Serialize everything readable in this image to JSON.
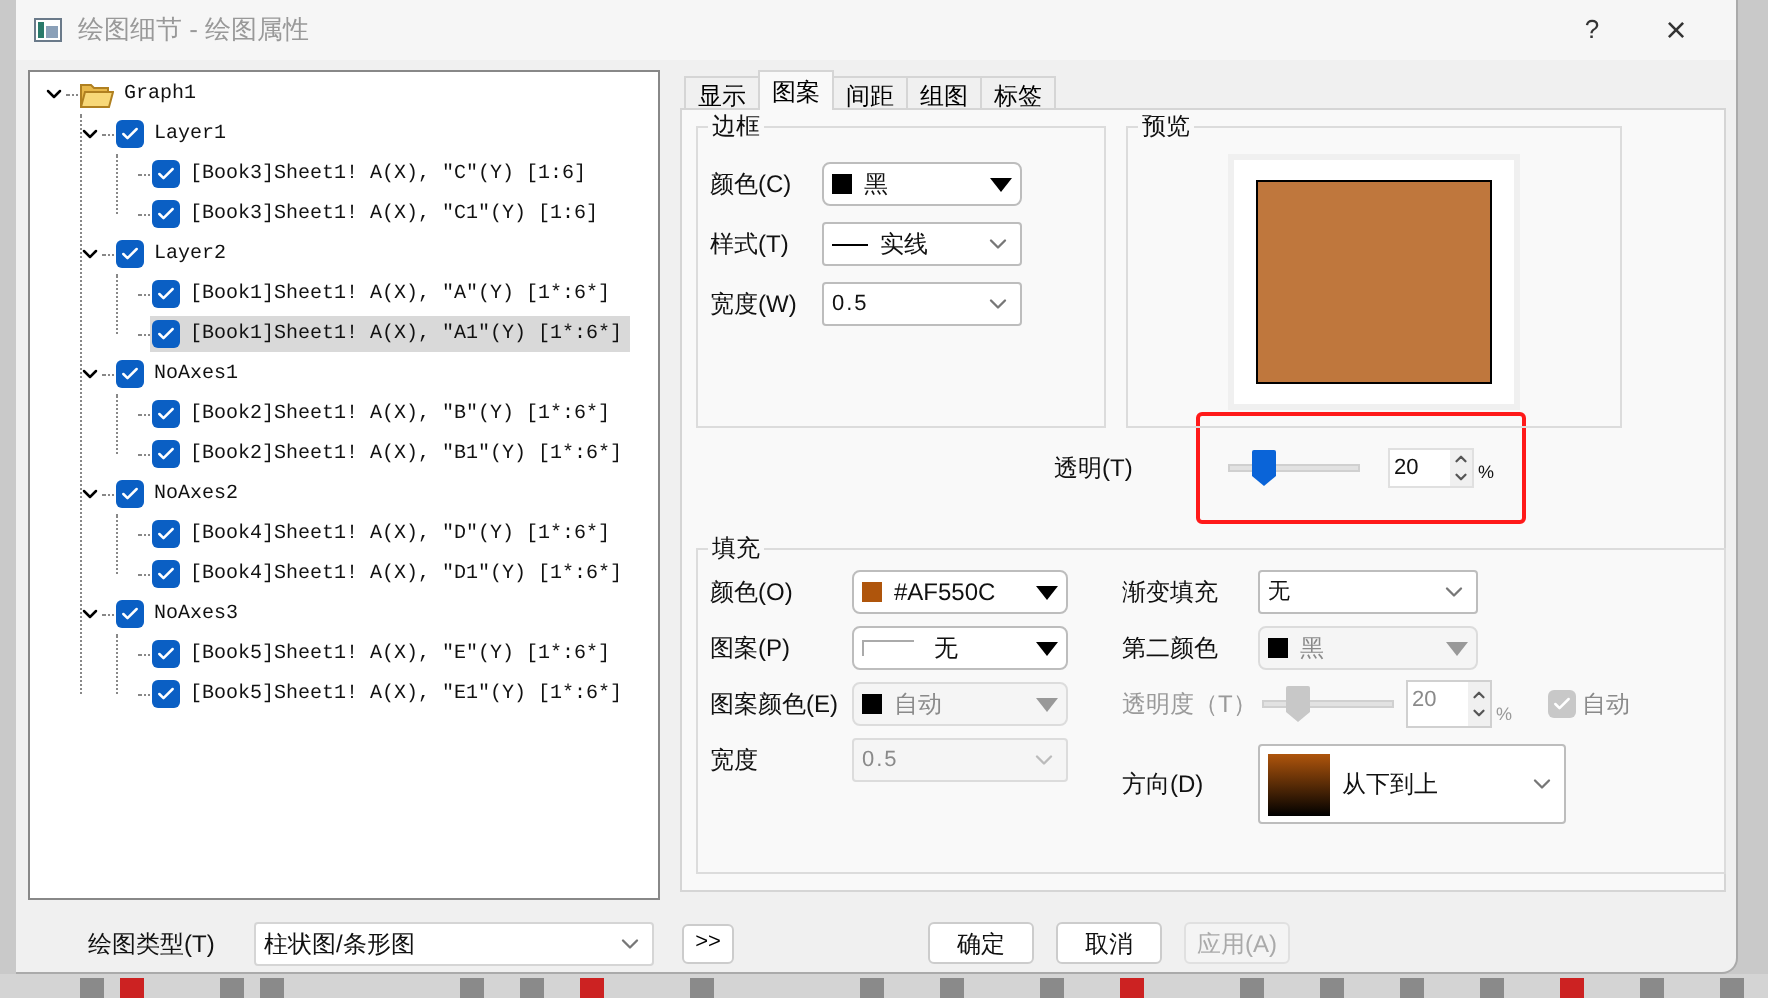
{
  "window": {
    "title": "绘图细节 - 绘图属性",
    "help_button": "?",
    "close_button": "×"
  },
  "tree": [
    {
      "kind": "folder",
      "label": "Graph1",
      "expanded": true,
      "selected": false,
      "children": [
        {
          "kind": "check",
          "label": "Layer1",
          "checked": true,
          "expanded": true,
          "selected": false,
          "children": [
            {
              "kind": "check",
              "label": "[Book3]Sheet1! A(X), \"C\"(Y) [1:6]",
              "checked": true,
              "selected": false
            },
            {
              "kind": "check",
              "label": "[Book3]Sheet1! A(X), \"C1\"(Y) [1:6]",
              "checked": true,
              "selected": false
            }
          ]
        },
        {
          "kind": "check",
          "label": "Layer2",
          "checked": true,
          "expanded": true,
          "selected": false,
          "children": [
            {
              "kind": "check",
              "label": "[Book1]Sheet1! A(X), \"A\"(Y) [1*:6*]",
              "checked": true,
              "selected": false
            },
            {
              "kind": "check",
              "label": "[Book1]Sheet1! A(X), \"A1\"(Y) [1*:6*]",
              "checked": true,
              "selected": true
            }
          ]
        },
        {
          "kind": "check",
          "label": "NoAxes1",
          "checked": true,
          "expanded": true,
          "selected": false,
          "children": [
            {
              "kind": "check",
              "label": "[Book2]Sheet1! A(X), \"B\"(Y) [1*:6*]",
              "checked": true,
              "selected": false
            },
            {
              "kind": "check",
              "label": "[Book2]Sheet1! A(X), \"B1\"(Y) [1*:6*]",
              "checked": true,
              "selected": false
            }
          ]
        },
        {
          "kind": "check",
          "label": "NoAxes2",
          "checked": true,
          "expanded": true,
          "selected": false,
          "children": [
            {
              "kind": "check",
              "label": "[Book4]Sheet1! A(X), \"D\"(Y) [1*:6*]",
              "checked": true,
              "selected": false
            },
            {
              "kind": "check",
              "label": "[Book4]Sheet1! A(X), \"D1\"(Y) [1*:6*]",
              "checked": true,
              "selected": false
            }
          ]
        },
        {
          "kind": "check",
          "label": "NoAxes3",
          "checked": true,
          "expanded": true,
          "selected": false,
          "children": [
            {
              "kind": "check",
              "label": "[Book5]Sheet1! A(X), \"E\"(Y) [1*:6*]",
              "checked": true,
              "selected": false
            },
            {
              "kind": "check",
              "label": "[Book5]Sheet1! A(X), \"E1\"(Y) [1*:6*]",
              "checked": true,
              "selected": false
            }
          ]
        }
      ]
    }
  ],
  "tabs": [
    {
      "label": "显示",
      "selected": false
    },
    {
      "label": "图案",
      "selected": true
    },
    {
      "label": "间距",
      "selected": false
    },
    {
      "label": "组图",
      "selected": false
    },
    {
      "label": "标签",
      "selected": false
    }
  ],
  "border": {
    "title": "边框",
    "fields": [
      {
        "kind": "color",
        "label": "颜色(C)",
        "value": "黑",
        "color": "#000000",
        "disabled": false
      },
      {
        "kind": "line",
        "label": "样式(T)",
        "value": "实线",
        "disabled": false
      },
      {
        "kind": "combo",
        "label": "宽度(W)",
        "value": "0.5",
        "disabled": false
      }
    ]
  },
  "preview": {
    "title": "预览"
  },
  "transparency": {
    "label": "透明(T)",
    "level": 0.2,
    "value": "20",
    "unit": "%"
  },
  "fill": {
    "title": "填充",
    "left": [
      {
        "kind": "color",
        "label": "颜色(O)",
        "value": "#AF550C",
        "color": "#af550c",
        "disabled": false
      },
      {
        "kind": "pattern",
        "label": "图案(P)",
        "value": "无",
        "disabled": false
      },
      {
        "kind": "color",
        "label": "图案颜色(E)",
        "value": "自动",
        "color": "#000000",
        "disabled": true
      },
      {
        "kind": "combo",
        "label": "宽度",
        "value": "0.5",
        "disabled": true
      }
    ],
    "right": [
      {
        "kind": "combo",
        "label": "渐变填充",
        "value": "无",
        "disabled": false
      },
      {
        "kind": "color",
        "label": "第二颜色",
        "value": "黑",
        "color": "#000000",
        "disabled": true
      },
      {
        "kind": "slider",
        "label": "透明度（T）",
        "level": 0.2,
        "value": "20",
        "unit": "%",
        "disabled": true,
        "auto": {
          "label": "自动",
          "checked": true
        }
      },
      {
        "kind": "gradient",
        "label": "方向(D)",
        "value": "从下到上",
        "disabled": false
      }
    ]
  },
  "plot_type": {
    "label": "绘图类型(T)",
    "value": "柱状图/条形图"
  },
  "expand_button": {
    "label": ">>"
  },
  "buttons": [
    {
      "label": "确定",
      "disabled": false
    },
    {
      "label": "取消",
      "disabled": false
    },
    {
      "label": "应用(A)",
      "disabled": true
    }
  ]
}
